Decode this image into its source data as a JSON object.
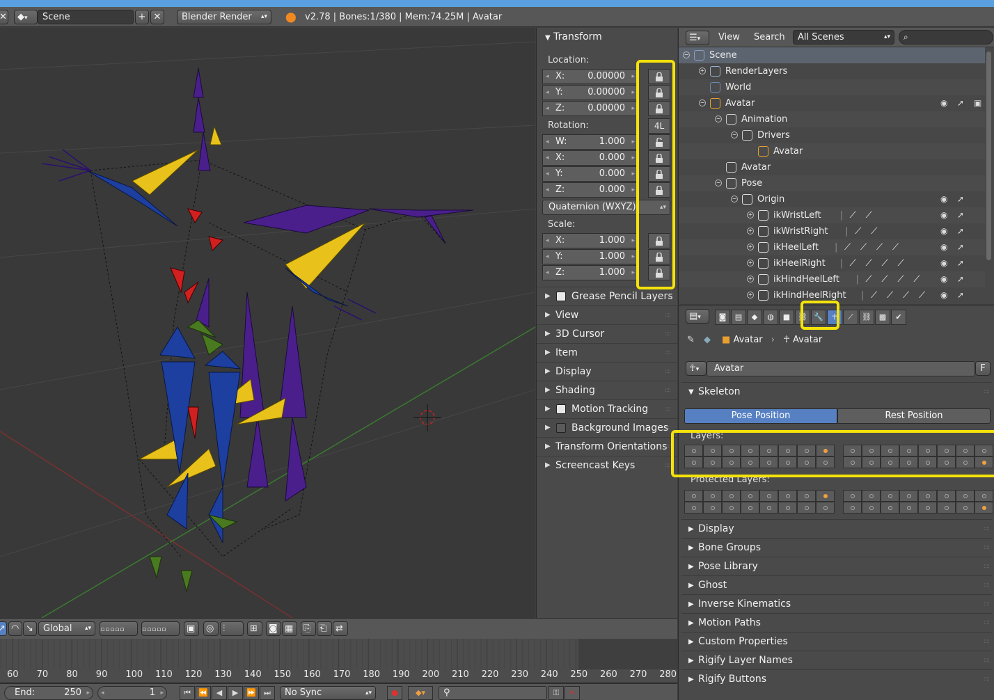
{
  "header": {
    "scene_name": "Scene",
    "render_engine": "Blender Render",
    "info": "v2.78 | Bones:1/380  | Mem:74.25M | Avatar"
  },
  "npanel": {
    "transform_title": "Transform",
    "location_label": "Location:",
    "location": [
      {
        "axis": "X:",
        "value": "0.00000"
      },
      {
        "axis": "Y:",
        "value": "0.00000"
      },
      {
        "axis": "Z:",
        "value": "0.00000"
      }
    ],
    "rotation_label": "Rotation:",
    "rotation_4l": "4L",
    "rotation": [
      {
        "axis": "W:",
        "value": "1.000"
      },
      {
        "axis": "X:",
        "value": "0.000"
      },
      {
        "axis": "Y:",
        "value": "0.000"
      },
      {
        "axis": "Z:",
        "value": "0.000"
      }
    ],
    "rotation_mode": "Quaternion (WXYZ)",
    "scale_label": "Scale:",
    "scale": [
      {
        "axis": "X:",
        "value": "1.000"
      },
      {
        "axis": "Y:",
        "value": "1.000"
      },
      {
        "axis": "Z:",
        "value": "1.000"
      }
    ],
    "sections": [
      {
        "label": "Grease Pencil Layers",
        "checkbox": true,
        "checked": true
      },
      {
        "label": "View"
      },
      {
        "label": "3D Cursor"
      },
      {
        "label": "Item"
      },
      {
        "label": "Display"
      },
      {
        "label": "Shading"
      },
      {
        "label": "Motion Tracking",
        "checkbox": true,
        "checked": true
      },
      {
        "label": "Background Images",
        "checkbox": true,
        "checked": false
      },
      {
        "label": "Transform Orientations"
      },
      {
        "label": "Screencast Keys"
      }
    ]
  },
  "outliner": {
    "view_label": "View",
    "search_label": "Search",
    "scene_filter": "All Scenes",
    "search_placeholder": "",
    "rows": [
      {
        "name": "Scene",
        "indent": 0,
        "expanded": true,
        "selected": true
      },
      {
        "name": "RenderLayers",
        "indent": 1,
        "expanded": false
      },
      {
        "name": "World",
        "indent": 1
      },
      {
        "name": "Avatar",
        "indent": 1,
        "expanded": true,
        "restrict": true
      },
      {
        "name": "Animation",
        "indent": 2,
        "expanded": true
      },
      {
        "name": "Drivers",
        "indent": 3,
        "expanded": true
      },
      {
        "name": "Avatar",
        "indent": 4
      },
      {
        "name": "Avatar",
        "indent": 2
      },
      {
        "name": "Pose",
        "indent": 2,
        "expanded": true
      },
      {
        "name": "Origin",
        "indent": 3,
        "expanded": true,
        "restrict": true,
        "bones": 0
      },
      {
        "name": "ikWristLeft",
        "indent": 4,
        "expanded": false,
        "restrict": true,
        "bones": 2
      },
      {
        "name": "ikWristRight",
        "indent": 4,
        "expanded": false,
        "restrict": true,
        "bones": 2
      },
      {
        "name": "ikHeelLeft",
        "indent": 4,
        "expanded": false,
        "restrict": true,
        "bones": 4
      },
      {
        "name": "ikHeelRight",
        "indent": 4,
        "expanded": false,
        "restrict": true,
        "bones": 4
      },
      {
        "name": "ikHindHeelLeft",
        "indent": 4,
        "expanded": false,
        "restrict": true,
        "bones": 4
      },
      {
        "name": "ikHindHeelRight",
        "indent": 4,
        "expanded": false,
        "restrict": true,
        "bones": 4
      }
    ]
  },
  "properties": {
    "breadcrumb": [
      "Avatar",
      "Avatar"
    ],
    "data_name": "Avatar",
    "fake_user": "F",
    "skeleton_title": "Skeleton",
    "pose_position": "Pose Position",
    "rest_position": "Rest Position",
    "layers_label": "Layers:",
    "protected_layers_label": "Protected Layers:",
    "sections": [
      "Display",
      "Bone Groups",
      "Pose Library",
      "Ghost",
      "Inverse Kinematics",
      "Motion Paths",
      "Custom Properties",
      "Rigify Layer Names",
      "Rigify Buttons"
    ]
  },
  "toolbar": {
    "orientation": "Global"
  },
  "timeline": {
    "frame_labels": [
      "60",
      "70",
      "80",
      "90",
      "100",
      "110",
      "120",
      "130",
      "140",
      "150",
      "160",
      "170",
      "180",
      "190",
      "200",
      "210",
      "220",
      "230",
      "240",
      "250",
      "260",
      "270",
      "280"
    ],
    "end_label": "End:",
    "end_value": "250",
    "current_frame": "1",
    "sync_mode": "No Sync"
  },
  "colors": {
    "accent_blue": "#5680c2",
    "highlight_yellow": "#f5e20a",
    "bone_gold": "#e8c21a",
    "bone_blue": "#1c3fa0",
    "bone_purple": "#4a1f8c"
  }
}
